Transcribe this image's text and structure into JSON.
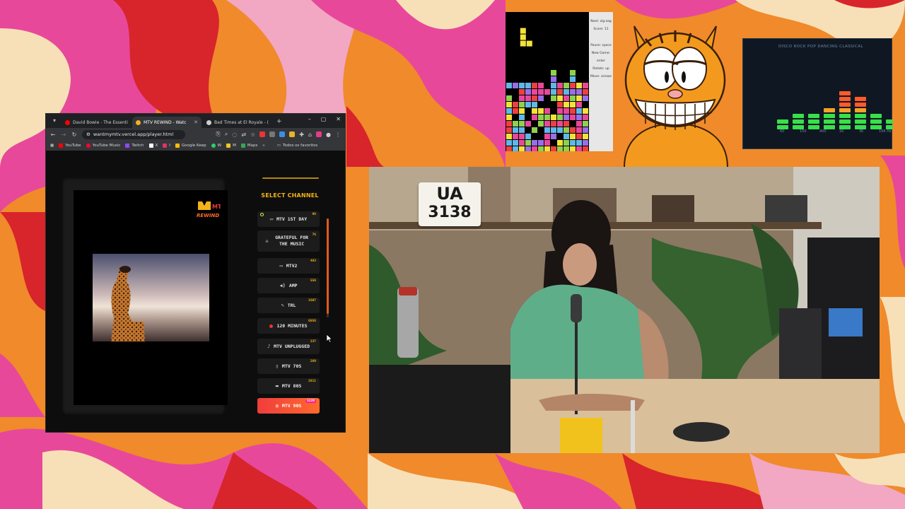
{
  "browser": {
    "tabs": [
      {
        "label": "David Bowie - The Essenti",
        "color": "#ff0000",
        "active": false
      },
      {
        "label": "MTV REWIND - Watc",
        "color": "#f3b21b",
        "active": true
      },
      {
        "label": "Bad Times at El Royale - (",
        "color": "#cfcfcf",
        "active": false
      }
    ],
    "url": "wantmymtv.vercel.app/player.html",
    "bookmarks": [
      {
        "label": "YouTube",
        "color": "#ff0000"
      },
      {
        "label": "YouTube Music",
        "color": "#ff0033"
      },
      {
        "label": "Twitch",
        "color": "#9146ff"
      },
      {
        "label": "X",
        "color": "#ffffff"
      },
      {
        "label": "I",
        "color": "#e1306c"
      },
      {
        "label": "Google Keep",
        "color": "#fbbc04"
      },
      {
        "label": "W",
        "color": "#25d366"
      },
      {
        "label": "M",
        "color": "#f3c623"
      },
      {
        "label": "Maps",
        "color": "#34a853"
      }
    ],
    "bookmarks_more": "»",
    "all_favorites": "Todos os favoritos"
  },
  "player": {
    "select_channel_label": "SELECT CHANNEL",
    "logo_text": "MTV",
    "logo_subtext": "REWIND",
    "channels": [
      {
        "name": "MTV 1ST DAY",
        "num": "96",
        "icon": "tv-icon"
      },
      {
        "name": "GRATEFUL FOR THE MUSIC",
        "num": "76",
        "icon": "skull-icon"
      },
      {
        "name": "MTV2",
        "num": "483",
        "icon": "tv-icon"
      },
      {
        "name": "AMP",
        "num": "556",
        "icon": "speaker-icon"
      },
      {
        "name": "TRL",
        "num": "1607",
        "icon": "microphone-icon"
      },
      {
        "name": "120 MINUTES",
        "num": "6856",
        "icon": "record-icon"
      },
      {
        "name": "MTV UNPLUGGED",
        "num": "337",
        "icon": "guitar-icon"
      },
      {
        "name": "MTV 70S",
        "num": "269",
        "icon": "phone-icon"
      },
      {
        "name": "MTV 80S",
        "num": "2811",
        "icon": "cassette-icon"
      },
      {
        "name": "MTV 90S",
        "num": "5220",
        "icon": "cd-icon",
        "active": true
      }
    ]
  },
  "tetris": {
    "next_label": "Next: zig-zag",
    "score_label": "Score: 11",
    "help": [
      "Pause: space",
      "New Game: enter",
      "Rotate: up",
      "Move: arrows"
    ]
  },
  "equalizer": {
    "title": "DISCO ROCK  POP  DANCING  CLASSICAL",
    "freq_labels": [
      "60",
      "150",
      "400",
      "1K",
      "3K",
      "15K Hz"
    ]
  },
  "webcam": {
    "plate_line1": "UA",
    "plate_line2": "3138"
  },
  "colors": {
    "accent": "#f3b21b",
    "active_channel": "#f03d3d",
    "bg_orange": "#f08a2b",
    "bg_pink": "#e8489a"
  }
}
